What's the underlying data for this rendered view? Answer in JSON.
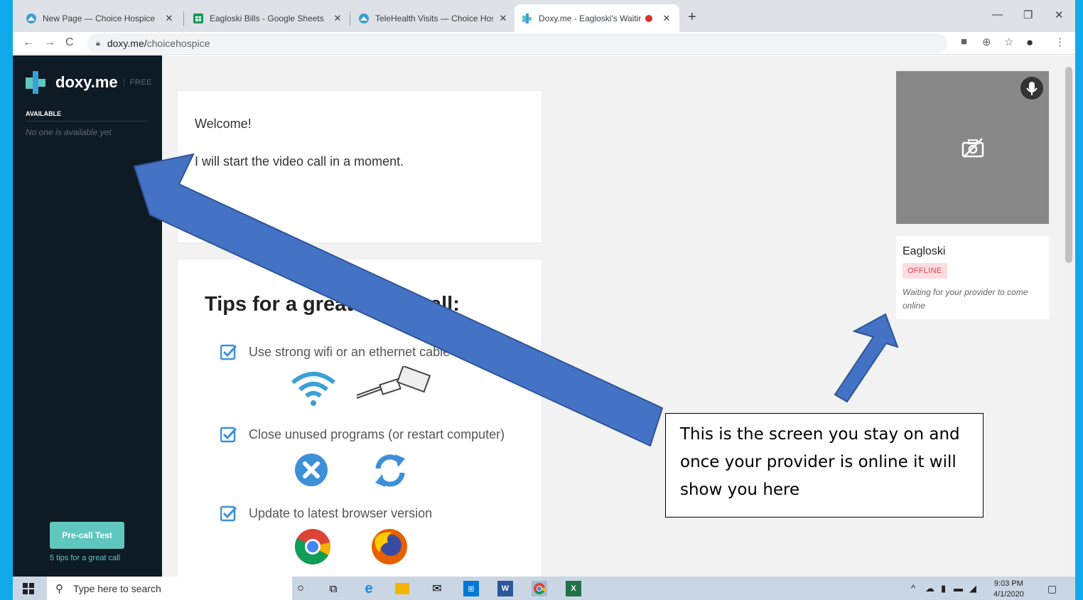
{
  "browser": {
    "tabs": [
      {
        "title": "New Page — Choice Hospice",
        "close": "✕"
      },
      {
        "title": "Eagloski Bills - Google Sheets",
        "close": "✕"
      },
      {
        "title": "TeleHealth Visits — Choice Hospi",
        "close": "✕"
      },
      {
        "title": "Doxy.me - Eagloski's Waiting",
        "close": "✕"
      }
    ],
    "new_tab": "+",
    "url_host": "doxy.me/",
    "url_path": "choicehospice"
  },
  "sidebar": {
    "logo_text": "doxy.me",
    "logo_badge": "FREE",
    "available_heading": "AVAILABLE",
    "available_text": "No one is available yet",
    "precall_button": "Pre-call Test",
    "tips_link": "5 tips for a great call"
  },
  "welcome": {
    "heading": "Welcome!",
    "message": "I will start the video call in a moment."
  },
  "tips": {
    "heading": "Tips for a great video call:",
    "items": [
      "Use strong wifi or an ethernet cable",
      "Close unused programs (or restart computer)",
      "Update to latest browser version"
    ]
  },
  "provider": {
    "name": "Eagloski",
    "status": "OFFLINE",
    "message": "Waiting for your provider to come online"
  },
  "annotation": {
    "callout": "This is the screen you stay on and once your provider is online it will show you here"
  },
  "taskbar": {
    "search_placeholder": "Type here to search",
    "time": "9:03 PM",
    "date": "4/1/2020"
  },
  "colors": {
    "desktop": "#12a9ec",
    "sidebar": "#0e1a24",
    "accent": "#5fc7be",
    "offline": "#d64550",
    "arrow": "#4472c4"
  }
}
